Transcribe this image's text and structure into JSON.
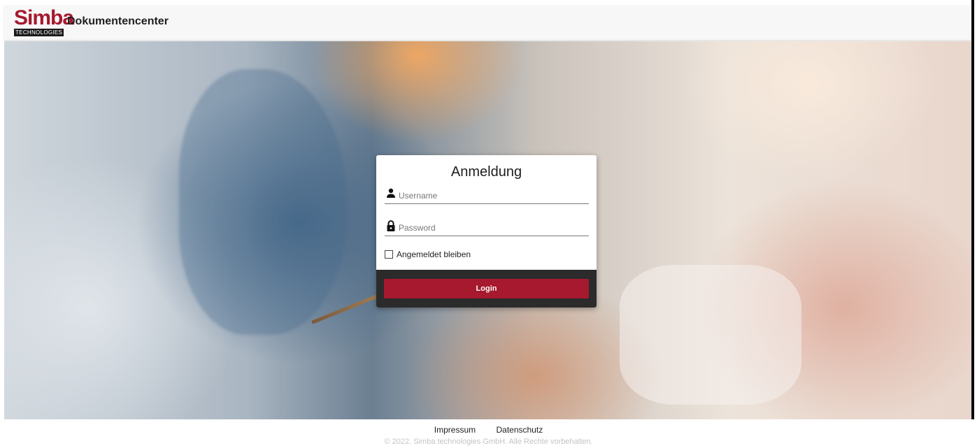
{
  "header": {
    "logo_text": "Simba",
    "logo_subtext": "TECHNOLOGIES",
    "title": "Dokumentencenter"
  },
  "login": {
    "title": "Anmeldung",
    "username_placeholder": "Username",
    "username_value": "",
    "password_placeholder": "Password",
    "password_value": "",
    "remember_label": "Angemeldet bleiben",
    "remember_checked": false,
    "button_label": "Login"
  },
  "footer": {
    "links": [
      "Impressum",
      "Datenschutz"
    ],
    "copyright": "© 2022. Simba technologies GmbH. Alle Rechte vorbehalten."
  },
  "colors": {
    "brand": "#a6192e",
    "card_footer": "#2b2b2b",
    "header_bg": "#f7f7f7"
  },
  "icons": {
    "username": "user-icon",
    "password": "lock-icon"
  }
}
